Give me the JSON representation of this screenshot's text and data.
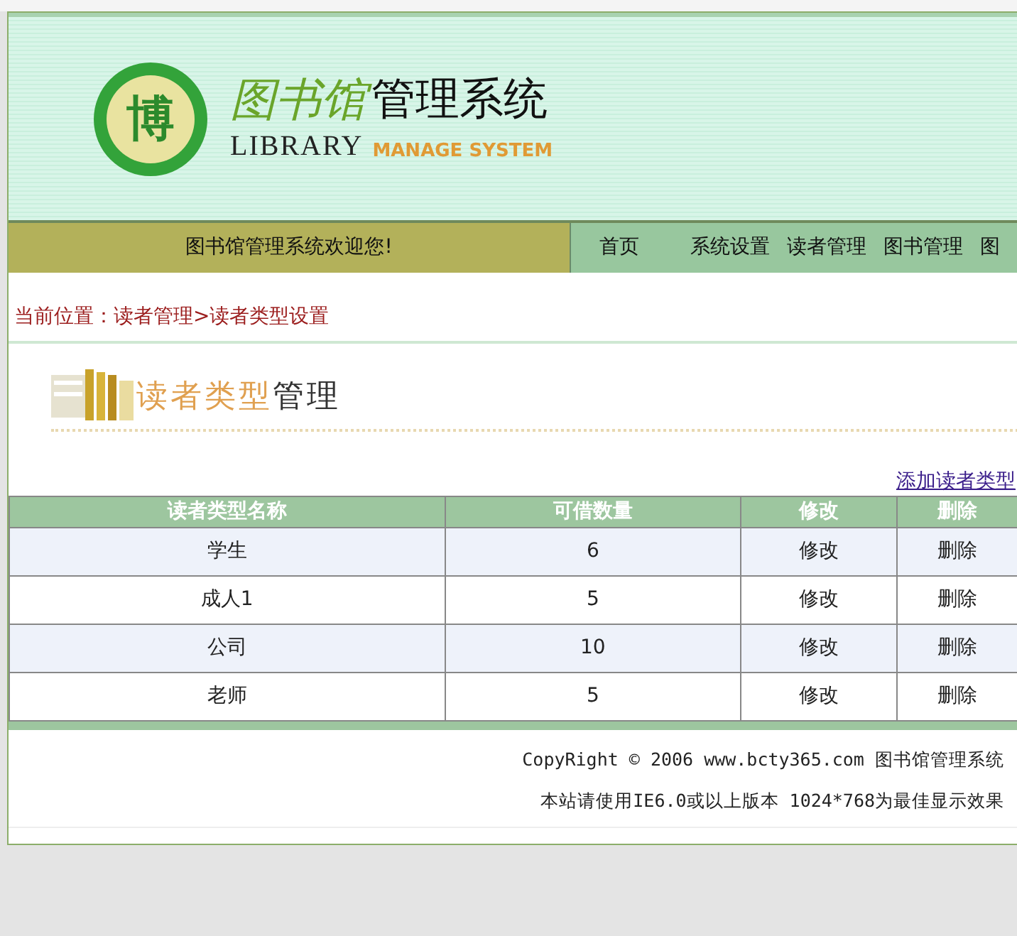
{
  "header": {
    "logo_char": "博",
    "title_art": "图书馆",
    "title": "管理系统",
    "subtitle_en": "LIBRARY",
    "subtitle_en2": "MANAGE SYSTEM"
  },
  "welcome": "图书馆管理系统欢迎您!",
  "nav": [
    "首页",
    "系统设置",
    "读者管理",
    "图书管理",
    "图"
  ],
  "breadcrumb": "当前位置：读者管理>读者类型设置",
  "banner": {
    "title_colored": "读者类型",
    "title_plain": "管理"
  },
  "add_link": "添加读者类型",
  "table": {
    "columns": [
      "读者类型名称",
      "可借数量",
      "修改",
      "删除"
    ],
    "rows": [
      {
        "name": "学生",
        "count": "6",
        "edit": "修改",
        "delete": "删除"
      },
      {
        "name": "成人1",
        "count": "5",
        "edit": "修改",
        "delete": "删除"
      },
      {
        "name": "公司",
        "count": "10",
        "edit": "修改",
        "delete": "删除"
      },
      {
        "name": "老师",
        "count": "5",
        "edit": "修改",
        "delete": "删除"
      }
    ]
  },
  "footer": [
    "CopyRight © 2006 www.bcty365.com 图书馆管理系统",
    "本站请使用IE6.0或以上版本 1024*768为最佳显示效果"
  ]
}
